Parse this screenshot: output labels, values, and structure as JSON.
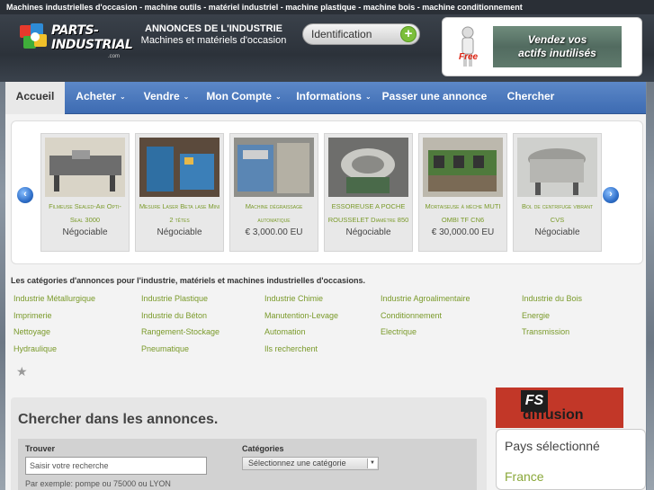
{
  "topbar": {
    "text": "Machines industrielles d'occasion - machine outils - matériel industriel - machine plastique - machine bois - machine conditionnement"
  },
  "header": {
    "logo_text": "PARTS-INDUSTRIAL",
    "logo_sub": ".com",
    "tagline_line1": "ANNONCES DE L'INDUSTRIE",
    "tagline_line2": "Machines et matériels d'occasion",
    "ident_label": "Identification",
    "promo_free": "Free",
    "promo_line1": "Vendez vos",
    "promo_line2": "actifs inutilisés"
  },
  "nav": {
    "items": [
      {
        "label": "Accueil"
      },
      {
        "label": "Acheter"
      },
      {
        "label": "Vendre"
      },
      {
        "label": "Mon Compte"
      },
      {
        "label": "Informations"
      },
      {
        "label": "Passer une annonce"
      },
      {
        "label": "Chercher"
      }
    ]
  },
  "carousel": {
    "items": [
      {
        "title": "Filmeuse Sealed-Air Opti-Seal 3000",
        "price": "Négociable"
      },
      {
        "title": "Mesure Laser Beta lase Mini 2 têtes",
        "price": "Négociable"
      },
      {
        "title": "Machine dégraissage automatique",
        "price": "€ 3,000.00 EU"
      },
      {
        "title": "ESSOREUSE A POCHE ROUSSELET Diamètre 850",
        "price": "Négociable"
      },
      {
        "title": "Mortaiseuse à mèche MUTI OMBI TF CN6",
        "price": "€ 30,000.00 EU"
      },
      {
        "title": "Bol de centrifuge vibrant CVS",
        "price": "Négociable"
      }
    ]
  },
  "categories": {
    "title": "Les catégories d'annonces pour l'industrie, matériels et machines industrielles d'occasions.",
    "rows": [
      [
        "Industrie Métallurgique",
        "Industrie Plastique",
        "Industrie Chimie",
        "Industrie Agroalimentaire",
        "Industrie du Bois"
      ],
      [
        "Imprimerie",
        "Industrie du Béton",
        "Manutention-Levage",
        "Conditionnement",
        "Energie"
      ],
      [
        "Nettoyage",
        "Rangement-Stockage",
        "Automation",
        "Electrique",
        "Transmission"
      ],
      [
        "Hydraulique",
        "Pneumatique",
        "Ils recherchent"
      ]
    ]
  },
  "search": {
    "title": "Chercher dans les annonces.",
    "trouver_label": "Trouver",
    "input_value": "Saisir votre recherche",
    "categories_label": "Catégories",
    "select_value": "Sélectionnez une catégorie",
    "example": "Par exemple: pompe ou 75000 ou LYON"
  },
  "side": {
    "fs_logo": "FS",
    "fs_word": "diffusion",
    "country_label": "Pays sélectionné",
    "country_value": "France"
  },
  "colors": {
    "nav_blue": "#3d6bb2",
    "link_green": "#7a9a2a",
    "accent_red": "#c23728"
  }
}
